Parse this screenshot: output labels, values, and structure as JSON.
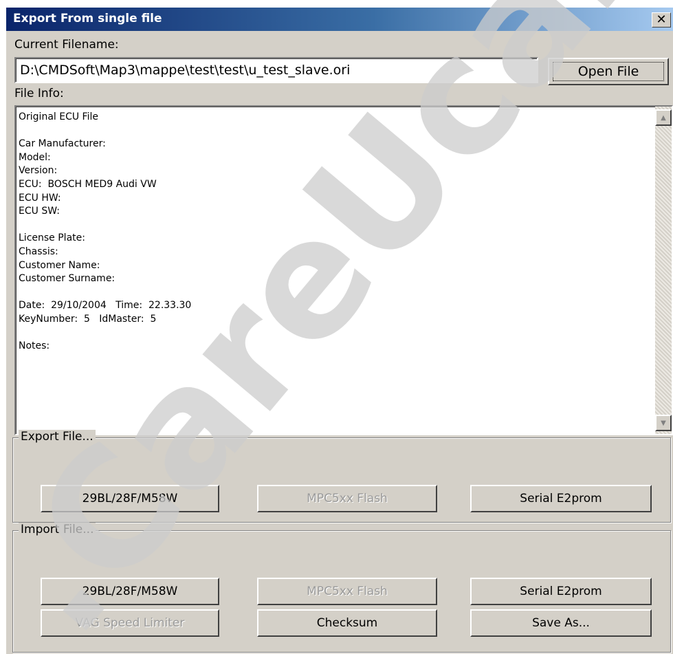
{
  "window": {
    "title": "Export From single file",
    "close_glyph": "✕"
  },
  "current_file": {
    "label": "Current Filename:",
    "value": "D:\\CMDSoft\\Map3\\mappe\\test\\test\\u_test_slave.ori",
    "open_button": "Open File"
  },
  "file_info": {
    "label": "File Info:",
    "lines": [
      "Original ECU File",
      "",
      "Car Manufacturer:",
      "Model:",
      "Version:",
      "ECU:  BOSCH MED9 Audi VW",
      "ECU HW:",
      "ECU SW:",
      "",
      "License Plate:",
      "Chassis:",
      "Customer Name:",
      "Customer Surname:",
      "",
      "Date:  29/10/2004   Time:  22.33.30",
      "KeyNumber:  5   IdMaster:  5",
      "",
      "Notes:"
    ]
  },
  "export_group": {
    "label": "Export File...",
    "buttons": {
      "flash_29bl": "29BL/28F/M58W",
      "mpc5xx": "MPC5xx Flash",
      "serial_e2prom": "Serial E2prom"
    }
  },
  "import_group": {
    "label": "Import File...",
    "buttons": {
      "flash_29bl": "29BL/28F/M58W",
      "mpc5xx": "MPC5xx Flash",
      "serial_e2prom": "Serial E2prom",
      "vag_speed_limiter": "VAG Speed Limiter",
      "checksum": "Checksum",
      "save_as": "Save As..."
    }
  },
  "watermark": {
    "text": ".CareUcar.c",
    "color": "#cccccc"
  },
  "icons": {
    "close": "close-icon",
    "scroll_up": "scroll-up-icon",
    "scroll_down": "scroll-down-icon"
  }
}
